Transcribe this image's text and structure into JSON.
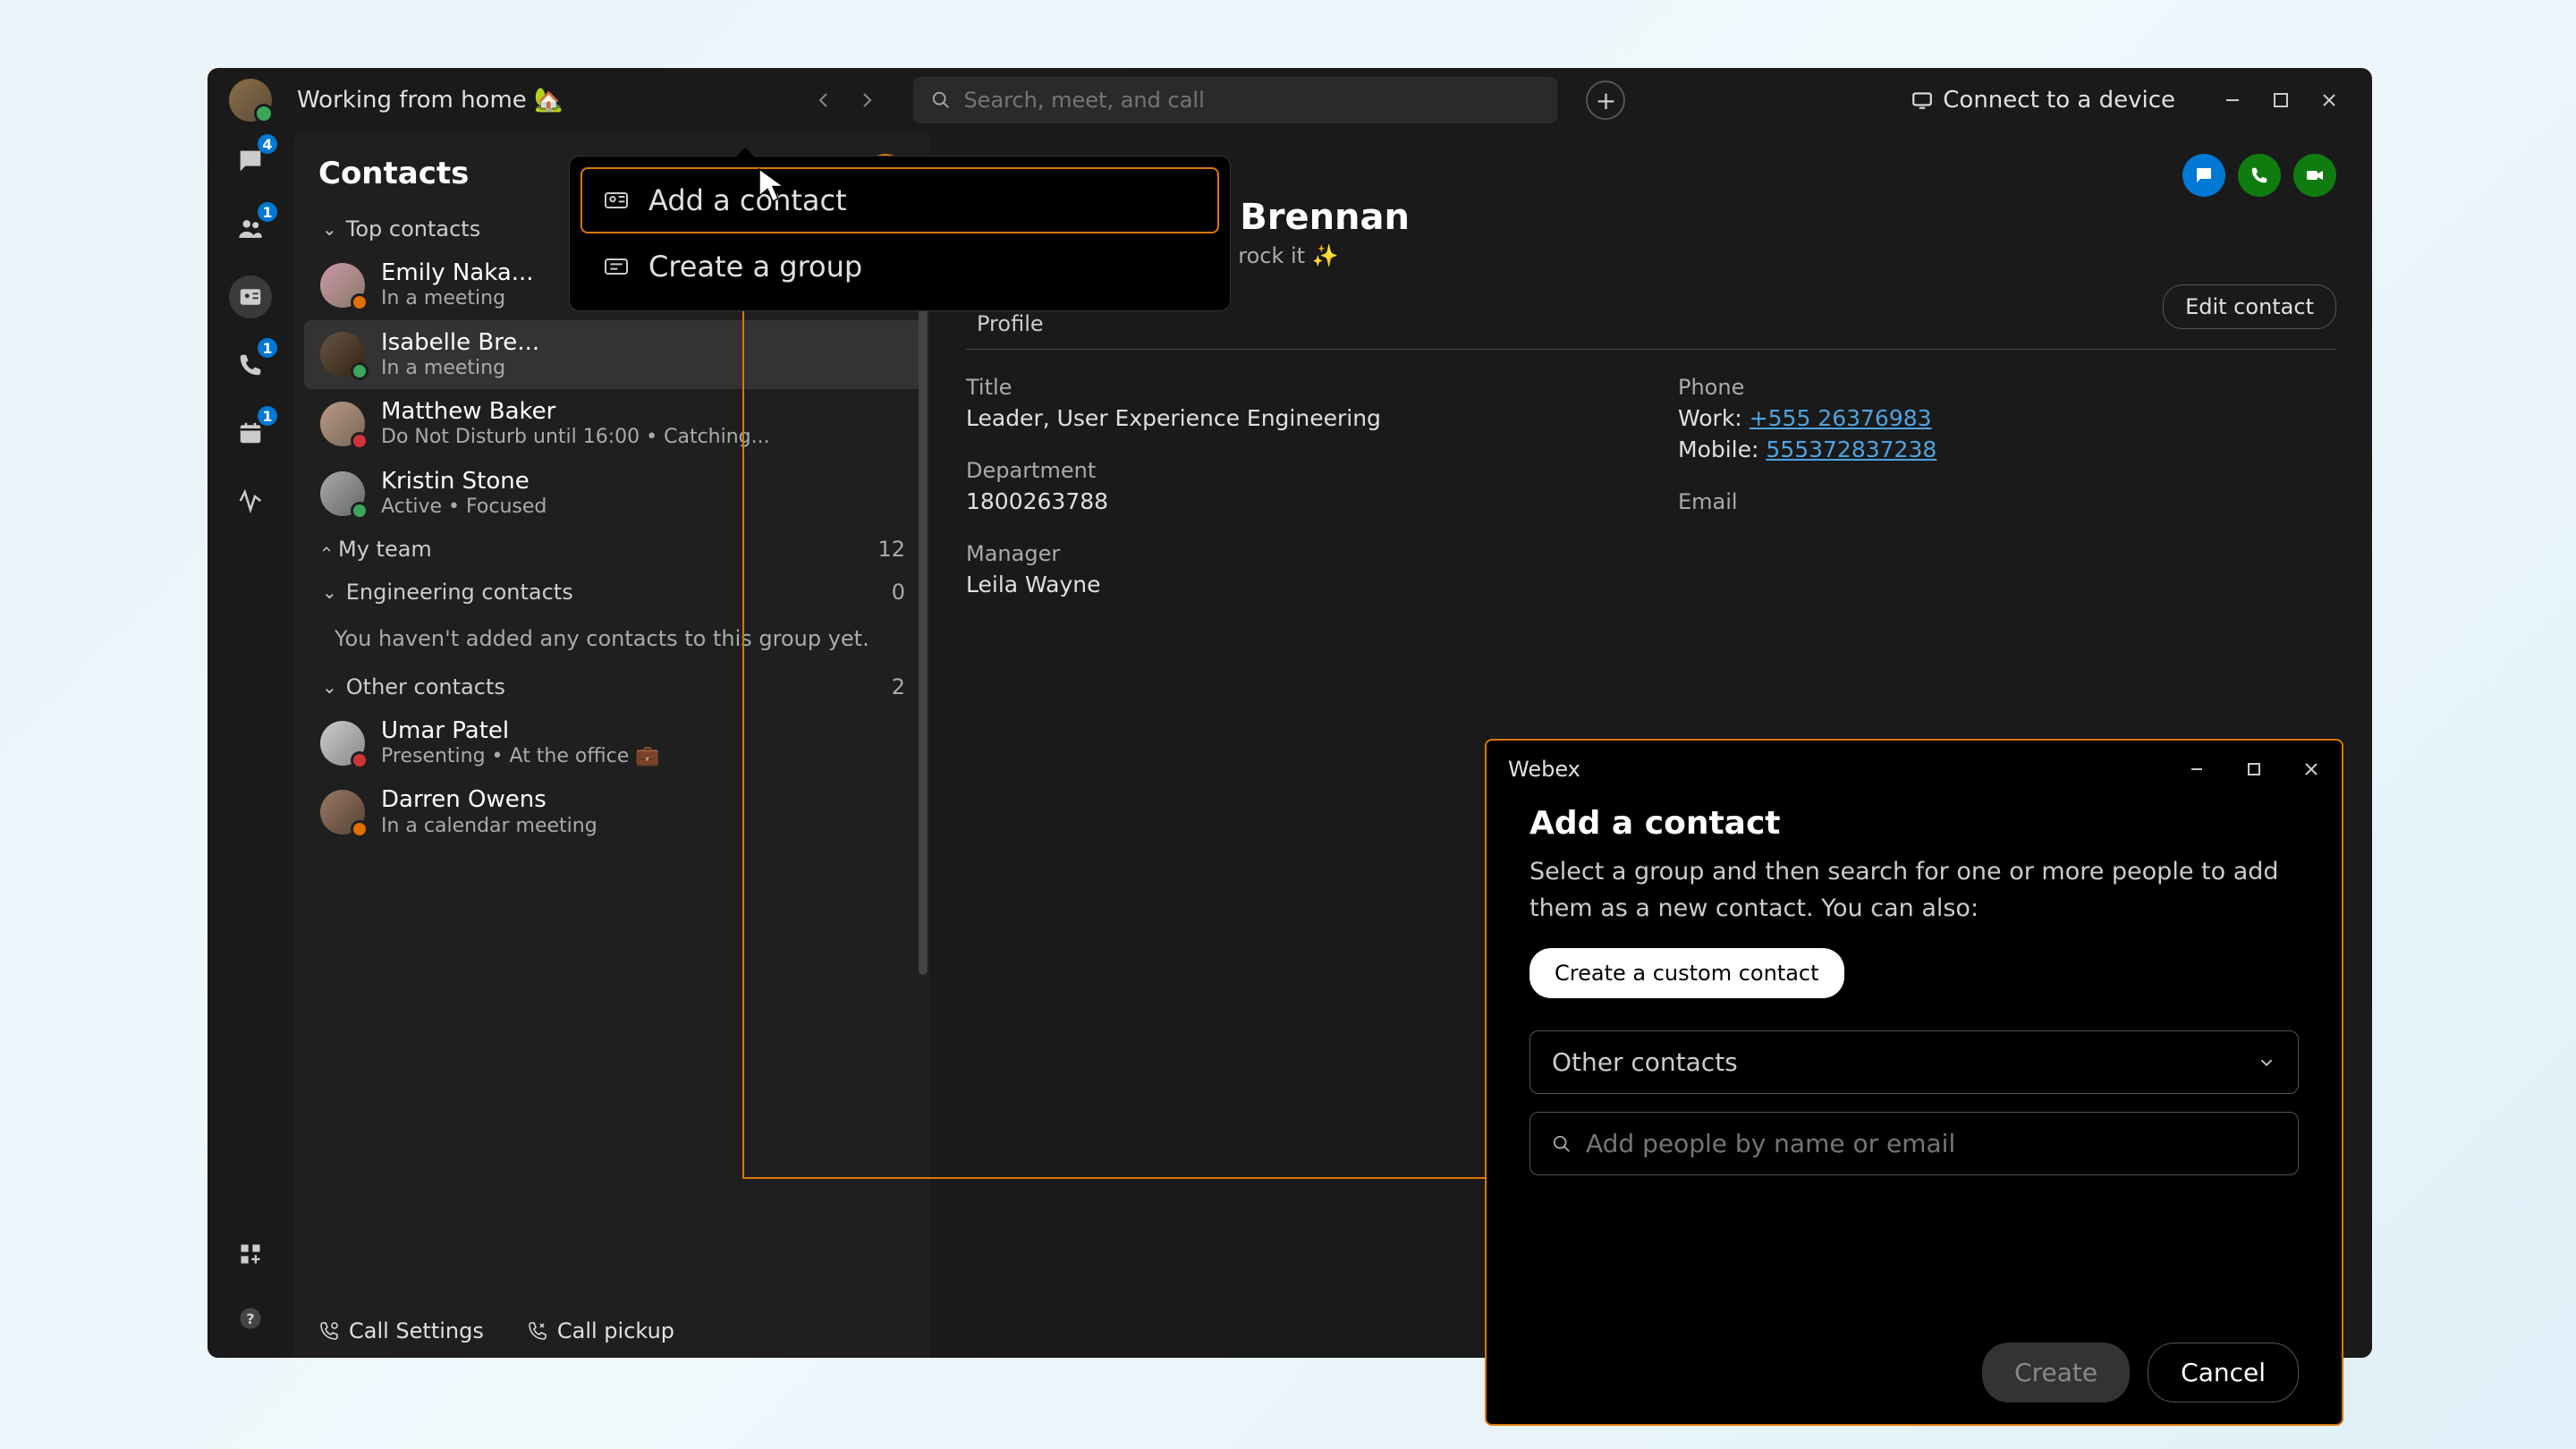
{
  "header": {
    "status": "Working from home 🏡",
    "search_placeholder": "Search, meet, and call",
    "connect_label": "Connect to a device"
  },
  "rail": {
    "messages_badge": "4",
    "teams_badge": "1",
    "calls_badge": "1",
    "meetings_badge": "1"
  },
  "contacts": {
    "title": "Contacts",
    "groups": {
      "top": {
        "label": "Top contacts"
      },
      "myteam": {
        "label": "My team",
        "count": "12"
      },
      "eng": {
        "label": "Engineering contacts",
        "count": "0",
        "empty": "You haven't added any contacts to this group yet."
      },
      "other": {
        "label": "Other contacts",
        "count": "2"
      }
    },
    "items": {
      "emily": {
        "name": "Emily Naka...",
        "status": "In a meeting"
      },
      "isabelle": {
        "name": "Isabelle Bre...",
        "status": "In a meeting"
      },
      "matthew": {
        "name": "Matthew Baker",
        "status": "Do Not Disturb until 16:00  •  Catching..."
      },
      "kristin": {
        "name": "Kristin Stone",
        "status": "Active  •  Focused"
      },
      "umar": {
        "name": "Umar Patel",
        "status": "Presenting  •  At the office 💼"
      },
      "darren": {
        "name": "Darren Owens",
        "status": "In a calendar meeting"
      }
    }
  },
  "bottom": {
    "call_settings": "Call Settings",
    "call_pickup": "Call pickup"
  },
  "menu": {
    "add_contact": "Add a contact",
    "create_group": "Create a group"
  },
  "detail": {
    "name": "belle Brennan",
    "status": "ve  •  Let's rock it ✨",
    "edit": "Edit contact",
    "profile_tab": "Profile",
    "title_label": "Title",
    "title_value": "Leader, User Experience Engineering",
    "dept_label": "Department",
    "dept_value": "1800263788",
    "mgr_label": "Manager",
    "mgr_value": "Leila Wayne",
    "phone_label": "Phone",
    "work_label": "Work:",
    "work_value": "+555 26376983",
    "mobile_label": "Mobile:",
    "mobile_value": "555372837238",
    "email_label": "Email"
  },
  "dialog": {
    "window_title": "Webex",
    "heading": "Add a contact",
    "description": "Select a group and then search for one or more people to add them as a new contact. You can also:",
    "custom_btn": "Create a custom contact",
    "group_selected": "Other contacts",
    "search_placeholder": "Add people by name or email",
    "create": "Create",
    "cancel": "Cancel"
  }
}
